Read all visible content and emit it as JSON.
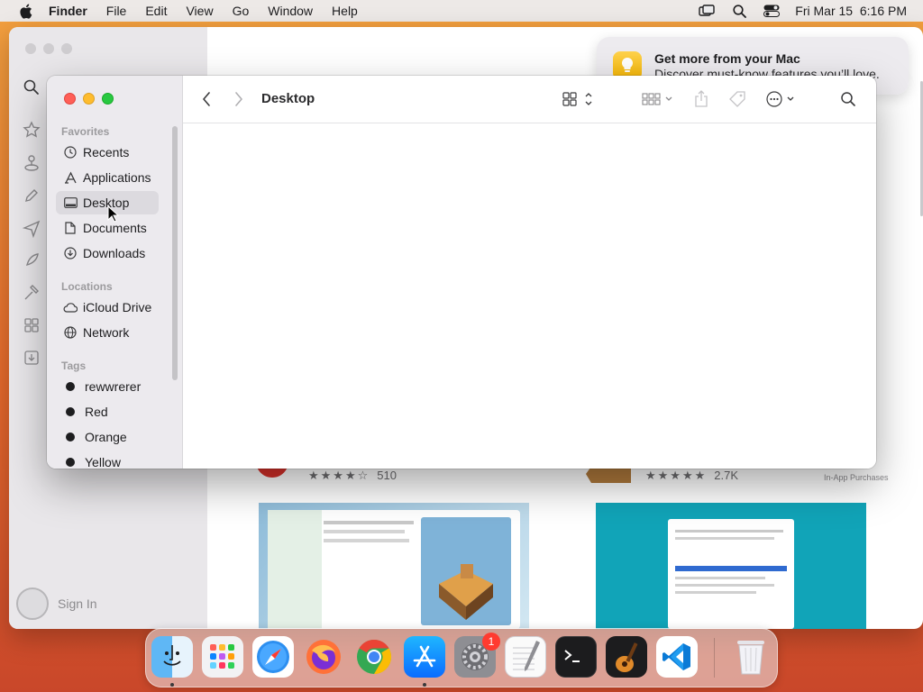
{
  "menubar": {
    "app_name": "Finder",
    "menus": [
      "File",
      "Edit",
      "View",
      "Go",
      "Window",
      "Help"
    ],
    "datetime": "Fri Mar 15  6:16 PM"
  },
  "notification": {
    "title": "Get more from your Mac",
    "body": "Discover must-know features you’ll love."
  },
  "finder": {
    "title": "Desktop",
    "sections": {
      "favorites": "Favorites",
      "locations": "Locations",
      "tags": "Tags"
    },
    "favorites": [
      {
        "label": "Recents",
        "icon": "clock-icon"
      },
      {
        "label": "Applications",
        "icon": "applications-icon"
      },
      {
        "label": "Desktop",
        "icon": "desktop-icon",
        "selected": true
      },
      {
        "label": "Documents",
        "icon": "document-icon"
      },
      {
        "label": "Downloads",
        "icon": "downloads-icon"
      }
    ],
    "locations": [
      {
        "label": "iCloud Drive",
        "icon": "cloud-icon"
      },
      {
        "label": "Network",
        "icon": "globe-icon"
      }
    ],
    "tags": [
      {
        "label": "rewwrerer",
        "color": "#1d1d1f"
      },
      {
        "label": "Red",
        "color": "#1d1d1f"
      },
      {
        "label": "Orange",
        "color": "#1d1d1f"
      },
      {
        "label": "Yellow",
        "color": "#1d1d1f"
      }
    ]
  },
  "appstore": {
    "sign_in": "Sign In",
    "rating1": {
      "stars": "★★★★☆",
      "count": "510"
    },
    "rating2": {
      "stars": "★★★★★",
      "count": "2.7K"
    },
    "in_app": "In-App Purchases"
  },
  "dock": {
    "apps": [
      "Finder",
      "Launchpad",
      "Safari",
      "Firefox",
      "Chrome",
      "App Store",
      "System Settings",
      "TextEdit",
      "Terminal",
      "GarageBand",
      "Visual Studio Code",
      "Trash"
    ],
    "badge_count": "1"
  },
  "colors": {
    "close": "#ff5f57",
    "minimize": "#febc2e",
    "maximize": "#28c840",
    "wallpaper": "#e66a2d"
  }
}
